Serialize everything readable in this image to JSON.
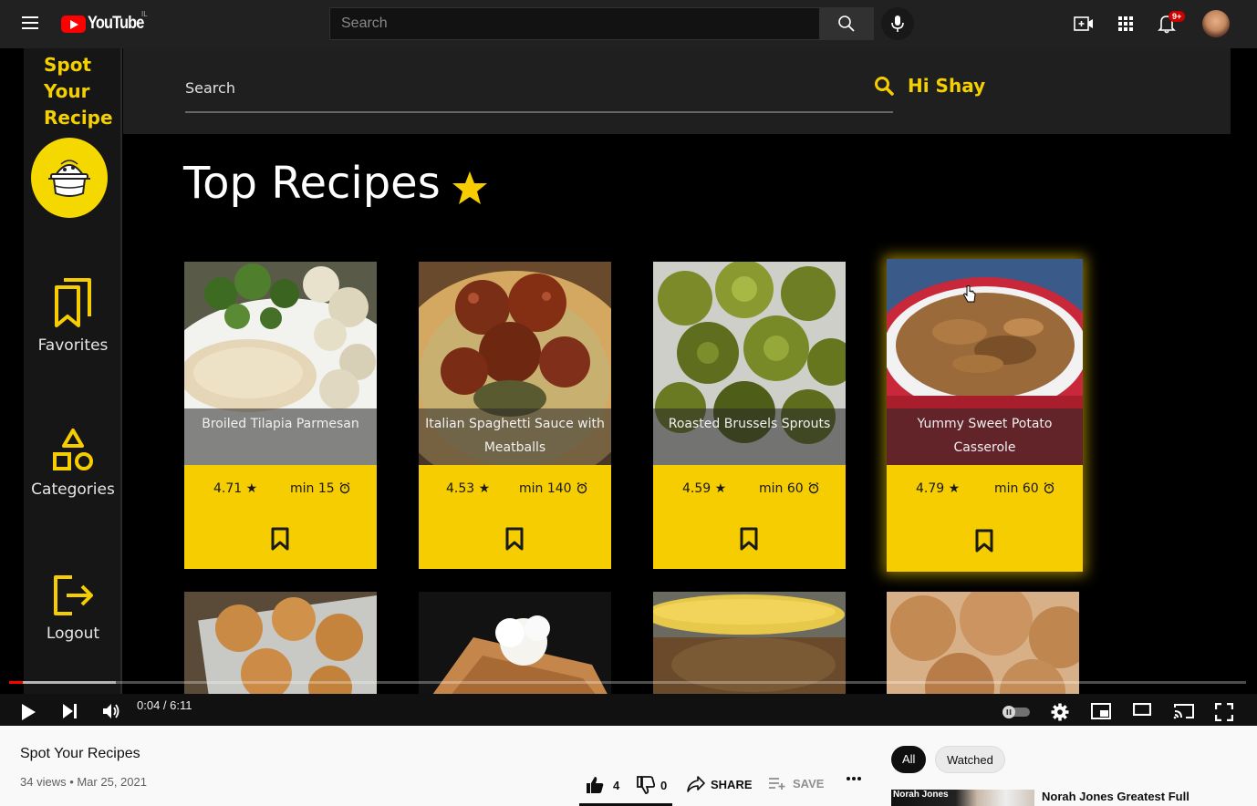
{
  "masthead": {
    "logo_text": "YouTube",
    "country_code": "IL",
    "search_placeholder": "Search",
    "notifications_badge": "9+"
  },
  "app": {
    "brand_lines": [
      "Spot",
      "Your",
      "Recipe"
    ],
    "nav": [
      {
        "label": "Favorites",
        "icon": "bookmark-stack-icon"
      },
      {
        "label": "Categories",
        "icon": "shapes-icon"
      },
      {
        "label": "Logout",
        "icon": "logout-icon"
      }
    ],
    "search_label": "Search",
    "greeting": "Hi Shay",
    "title": "Top Recipes",
    "accent_color": "#f5cd00",
    "recipes": [
      {
        "name_line1": "Broiled Tilapia Parmesan",
        "name_line2": "",
        "rating": "4.71 ★",
        "time": "min 15"
      },
      {
        "name_line1": "Italian Spaghetti Sauce with",
        "name_line2": "Meatballs",
        "rating": "4.53 ★",
        "time": "min 140"
      },
      {
        "name_line1": "Roasted Brussels Sprouts",
        "name_line2": "",
        "rating": "4.59 ★",
        "time": "min 60"
      },
      {
        "name_line1": "Yummy Sweet Potato",
        "name_line2": "Casserole",
        "rating": "4.79 ★",
        "time": "min 60"
      }
    ]
  },
  "player": {
    "time_display": "0:04 / 6:11",
    "progress_fraction": 0.011
  },
  "video": {
    "title": "Spot Your Recipes",
    "meta": "34 views • Mar 25, 2021",
    "likes": "4",
    "dislikes": "0",
    "share_label": "SHARE",
    "save_label": "SAVE"
  },
  "sidebar_recs": {
    "chips": [
      "All",
      "Watched"
    ],
    "first_rec_thumb_text": "Norah Jones",
    "first_rec_title": "Norah Jones Greatest Full"
  }
}
